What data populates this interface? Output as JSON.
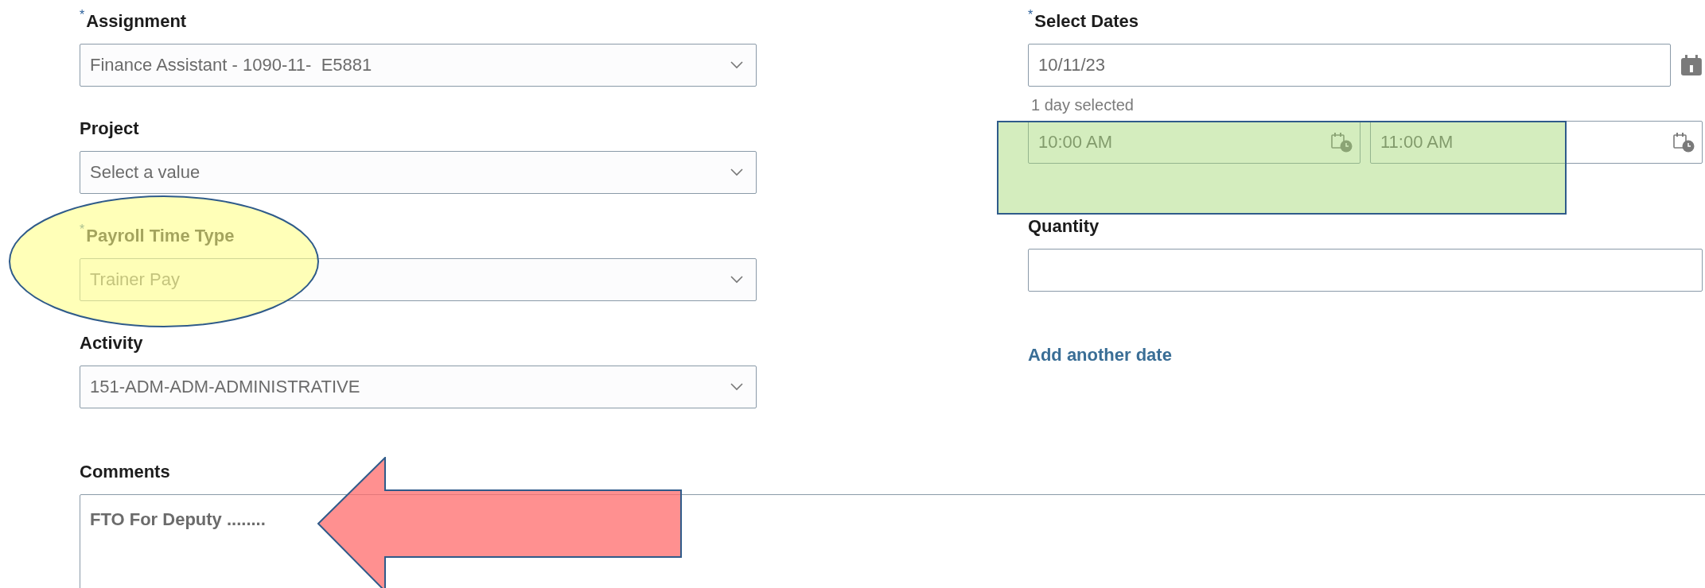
{
  "left_fields": [
    {
      "label": "Assignment",
      "required_mark": "*",
      "value": "Finance Assistant - 1090-11-  E5881"
    },
    {
      "label": "Project",
      "placeholder": "Select a value"
    },
    {
      "label": "Payroll Time Type",
      "required_mark": "*",
      "value": "Trainer Pay"
    },
    {
      "label": "Activity",
      "value": "151-ADM-ADM-ADMINISTRATIVE"
    }
  ],
  "select_dates": {
    "label": "Select Dates",
    "required_mark": "*",
    "value": "10/11/23",
    "hint": "1 day selected",
    "start_time": "10:00 AM",
    "end_time": "11:00 AM"
  },
  "quantity": {
    "label": "Quantity"
  },
  "add_date_link": "Add another date",
  "comments": {
    "label": "Comments",
    "value": "FTO For Deputy ........"
  },
  "annotations": [
    {
      "kind": "ellipse"
    },
    {
      "kind": "box"
    },
    {
      "kind": "arrow"
    }
  ]
}
